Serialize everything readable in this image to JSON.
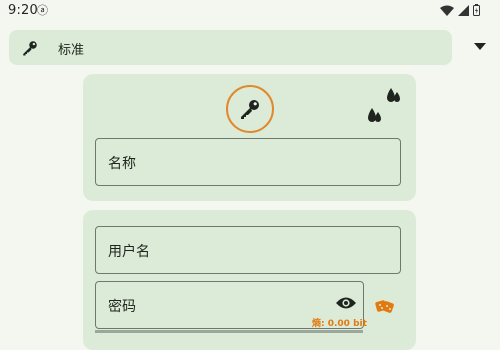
{
  "status_bar": {
    "time": "9:20",
    "sync_glyph": "ⓐ"
  },
  "type_row": {
    "label": "标准"
  },
  "entry": {
    "name_label": "名称",
    "username_label": "用户名",
    "password_label": "密码",
    "entropy": "熵: 0.00 bit"
  },
  "icons": {
    "key": "key-icon",
    "entry_icon": "key-icon",
    "color_droplets": "water-drop-icon",
    "visibility": "eye-icon",
    "generator": "dice-icon",
    "dropdown": "chevron-down-icon"
  },
  "colors": {
    "accent": "#e0892a",
    "card": "#dcebd7",
    "background": "#f3f7f0"
  }
}
